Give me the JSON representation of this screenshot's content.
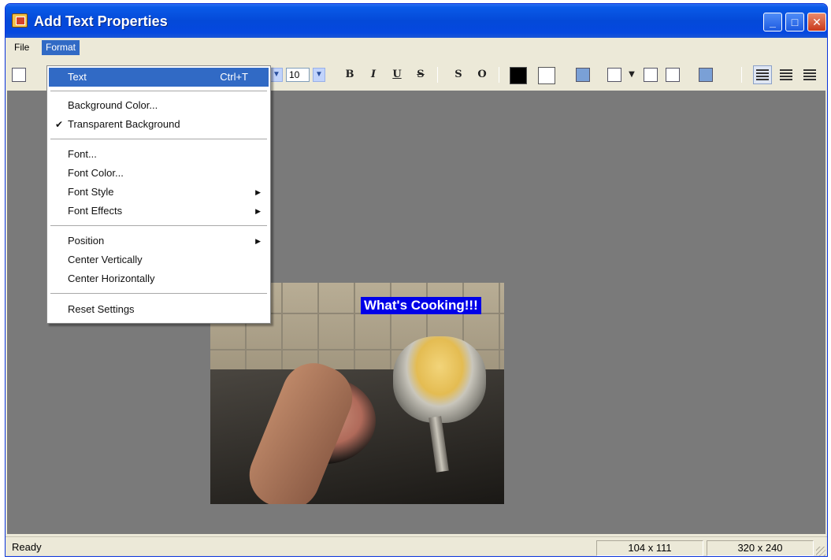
{
  "window": {
    "title": "Add Text Properties"
  },
  "menubar": {
    "file_label": "File",
    "format_label": "Format"
  },
  "toolbar": {
    "font_size": "10",
    "bold_label": "B",
    "italic_label": "I",
    "underline_label": "U",
    "strike_label": "S",
    "shadow_label": "S",
    "outline_label": "O"
  },
  "format_menu": {
    "text": "Text",
    "text_shortcut": "Ctrl+T",
    "background_color": "Background Color...",
    "transparent_background": "Transparent Background",
    "transparent_background_checked": true,
    "font": "Font...",
    "font_color": "Font Color...",
    "font_style": "Font Style",
    "font_effects": "Font Effects",
    "position": "Position",
    "center_vertically": "Center Vertically",
    "center_horizontally": "Center Horizontally",
    "reset_settings": "Reset Settings"
  },
  "canvas": {
    "overlay_text": "What's Cooking!!!"
  },
  "statusbar": {
    "status": "Ready",
    "cursor_position": "104 x 111",
    "image_size": "320 x 240"
  },
  "colors": {
    "titlebar": "#0449d8",
    "highlight": "#316ac5",
    "canvas_background": "#7a7a7a",
    "overlay_text_background": "#0000e8"
  }
}
